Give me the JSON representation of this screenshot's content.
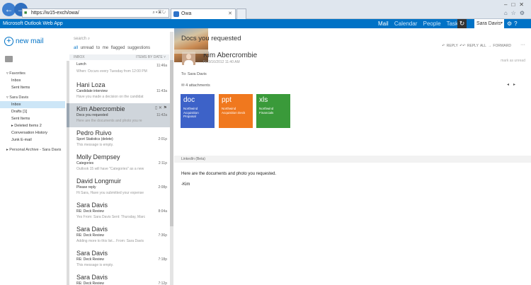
{
  "browser": {
    "url": "https://w15-exch/owa/",
    "tab_title": "Owa"
  },
  "topbar": {
    "app_name": "Microsoft Outlook Web App",
    "nav": [
      "Mail",
      "Calendar",
      "People",
      "Tasks"
    ],
    "user_name": "Sara Davis"
  },
  "sidebar": {
    "new_mail": "new mail",
    "items": [
      {
        "label": "▿ Favorites",
        "indent": 0,
        "type": "head"
      },
      {
        "label": "Inbox",
        "indent": 1
      },
      {
        "label": "Sent Items",
        "indent": 1
      },
      {
        "label": "▿ Sara Davis",
        "indent": 0,
        "type": "head"
      },
      {
        "label": "Inbox",
        "indent": 1,
        "selected": true
      },
      {
        "label": "Drafts [1]",
        "indent": 1
      },
      {
        "label": "Sent Items",
        "indent": 1
      },
      {
        "label": "▸ Deleted Items 2",
        "indent": 1
      },
      {
        "label": "Conversation History",
        "indent": 1
      },
      {
        "label": "Junk E-mail",
        "indent": 1
      },
      {
        "label": "▸ Personal Archive - Sara Davis",
        "indent": 0,
        "type": "head"
      }
    ]
  },
  "list": {
    "search_placeholder": "search",
    "filters": [
      "all",
      "unread",
      "to me",
      "flagged",
      "suggestions"
    ],
    "header_left": "INBOX",
    "header_right": "ITEMS BY DATE ˅",
    "messages": [
      {
        "sender": "",
        "subject": "Lunch",
        "preview": "When: Occurs every Tuesday from 12:00 PM",
        "time": "11:46a",
        "first": true
      },
      {
        "sender": "Hani Loza",
        "subject": "Candidate interview",
        "preview": "Have you made a decision on the candidat",
        "time": "11:43a"
      },
      {
        "sender": "Kim Abercrombie",
        "subject": "Docs you requested",
        "preview": "Here are the documents and photo you re",
        "time": "11:42a",
        "selected": true
      },
      {
        "sender": "Pedro Ruivo",
        "subject": "Sport Statistics (delete)",
        "preview": "This message is empty.",
        "time": "2:01p"
      },
      {
        "sender": "Molly Dempsey",
        "subject": "Categories",
        "preview": "Outlook 15 will have \"Categories\" as a new",
        "time": "2:11p"
      },
      {
        "sender": "David Longmuir",
        "subject": "Please reply",
        "preview": "Hi Sara, Have you submitted your expense",
        "time": "2:08p"
      },
      {
        "sender": "Sara Davis",
        "subject": "RE: Deck Review",
        "preview": "Yes From: Sara Davis Sent: Thursday, Marc",
        "time": "8:04a"
      },
      {
        "sender": "Sara Davis",
        "subject": "RE: Deck Review",
        "preview": "Adding more to this list... From: Sara Davis",
        "time": "7:36p"
      },
      {
        "sender": "Sara Davis",
        "subject": "RE: Deck Review",
        "preview": "This message is empty.",
        "time": "7:18p"
      },
      {
        "sender": "Sara Davis",
        "subject": "RE: Deck Review",
        "preview": "",
        "time": "7:12p"
      }
    ]
  },
  "reading": {
    "title": "Docs you requested",
    "sender": "Kim Abercrombie",
    "sent": "Fri 3/16/2012 11:40 AM",
    "to": "To: Sara Davis",
    "actions": [
      "↶ REPLY",
      "↶↶ REPLY ALL",
      "→ FORWARD"
    ],
    "more": "···",
    "mark_unread": "mark as unread",
    "attachments_count": "4 attachments",
    "attachments": [
      {
        "ext": "doc",
        "name": "Northwind Acquisition Proposal",
        "color": "#3d62c8"
      },
      {
        "ext": "ppt",
        "name": "Northwind Acquisition Deck",
        "color": "#f0781e"
      },
      {
        "ext": "xls",
        "name": "Northwind Financials",
        "color": "#3a9a3a"
      }
    ],
    "linkedin": "LinkedIn (Beta)",
    "body_line1": "Here are the documents and photo you requested.",
    "body_line2": "-Kim"
  }
}
